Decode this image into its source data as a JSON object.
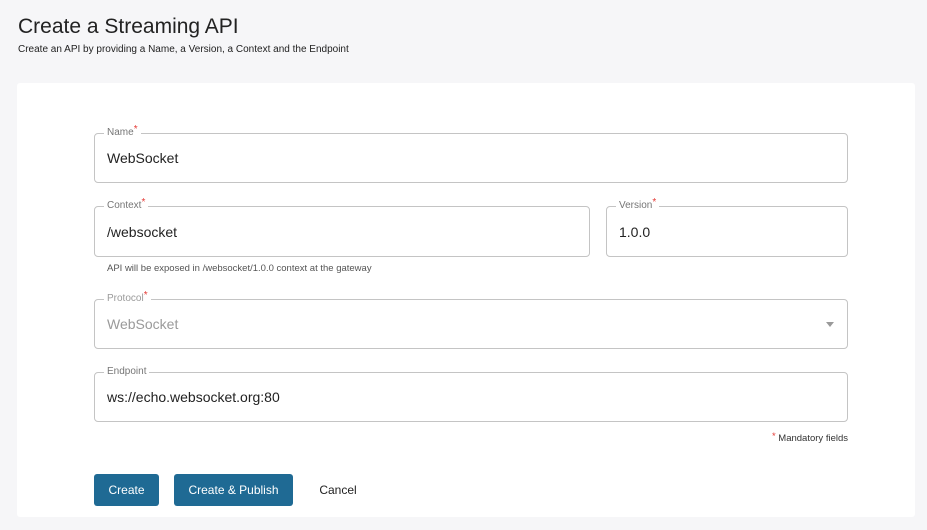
{
  "header": {
    "title": "Create a Streaming API",
    "subtitle": "Create an API by providing a Name, a Version, a Context and the Endpoint"
  },
  "form": {
    "required_mark": "*",
    "name": {
      "label": "Name",
      "value": "WebSocket"
    },
    "context": {
      "label": "Context",
      "value": "/websocket",
      "helper": "API will be exposed in /websocket/1.0.0 context at the gateway"
    },
    "version": {
      "label": "Version",
      "value": "1.0.0"
    },
    "protocol": {
      "label": "Protocol",
      "value": "WebSocket",
      "disabled": true
    },
    "endpoint": {
      "label": "Endpoint",
      "value": "ws://echo.websocket.org:80"
    },
    "mandatory_note": "Mandatory fields"
  },
  "actions": {
    "create_label": "Create",
    "create_publish_label": "Create & Publish",
    "cancel_label": "Cancel"
  },
  "colors": {
    "primary": "#1f6a94",
    "required": "#e53935",
    "background": "#f6f6f8"
  }
}
